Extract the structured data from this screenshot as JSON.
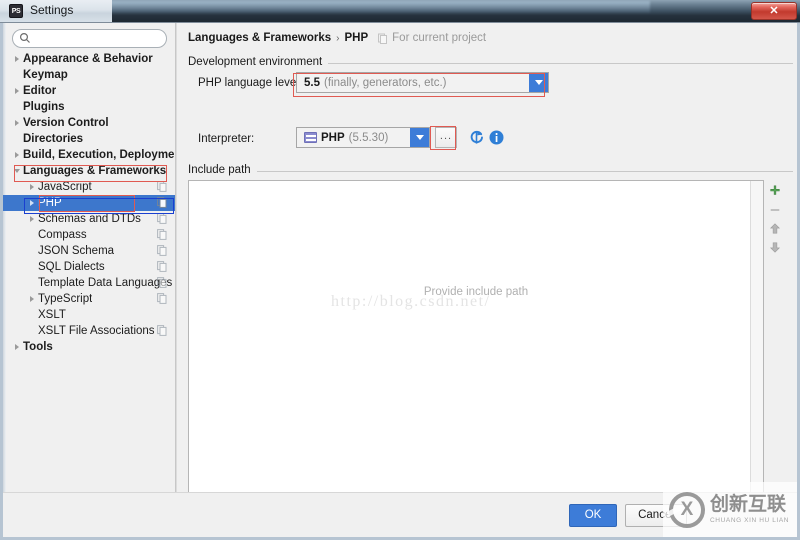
{
  "window": {
    "title": "Settings",
    "app_icon": "PS",
    "close_label": "✕"
  },
  "sidebar": {
    "search": {
      "value": "",
      "placeholder": ""
    },
    "items": [
      {
        "label": "Appearance & Behavior",
        "level": 0,
        "twisty": "right",
        "bold": true,
        "cfg": false,
        "selected": false
      },
      {
        "label": "Keymap",
        "level": 0,
        "twisty": "none",
        "bold": true,
        "cfg": false,
        "selected": false
      },
      {
        "label": "Editor",
        "level": 0,
        "twisty": "right",
        "bold": true,
        "cfg": false,
        "selected": false
      },
      {
        "label": "Plugins",
        "level": 0,
        "twisty": "none",
        "bold": true,
        "cfg": false,
        "selected": false
      },
      {
        "label": "Version Control",
        "level": 0,
        "twisty": "right",
        "bold": true,
        "cfg": false,
        "selected": false
      },
      {
        "label": "Directories",
        "level": 0,
        "twisty": "none",
        "bold": true,
        "cfg": false,
        "selected": false
      },
      {
        "label": "Build, Execution, Deployment",
        "level": 0,
        "twisty": "right",
        "bold": true,
        "cfg": false,
        "selected": false
      },
      {
        "label": "Languages & Frameworks",
        "level": 0,
        "twisty": "down",
        "bold": true,
        "cfg": false,
        "selected": false
      },
      {
        "label": "JavaScript",
        "level": 1,
        "twisty": "right",
        "bold": false,
        "cfg": true,
        "selected": false
      },
      {
        "label": "PHP",
        "level": 1,
        "twisty": "right",
        "bold": false,
        "cfg": true,
        "selected": true
      },
      {
        "label": "Schemas and DTDs",
        "level": 1,
        "twisty": "right",
        "bold": false,
        "cfg": true,
        "selected": false
      },
      {
        "label": "Compass",
        "level": 1,
        "twisty": "none",
        "bold": false,
        "cfg": true,
        "selected": false
      },
      {
        "label": "JSON Schema",
        "level": 1,
        "twisty": "none",
        "bold": false,
        "cfg": true,
        "selected": false
      },
      {
        "label": "SQL Dialects",
        "level": 1,
        "twisty": "none",
        "bold": false,
        "cfg": true,
        "selected": false
      },
      {
        "label": "Template Data Languages",
        "level": 1,
        "twisty": "none",
        "bold": false,
        "cfg": true,
        "selected": false
      },
      {
        "label": "TypeScript",
        "level": 1,
        "twisty": "right",
        "bold": false,
        "cfg": true,
        "selected": false
      },
      {
        "label": "XSLT",
        "level": 1,
        "twisty": "none",
        "bold": false,
        "cfg": false,
        "selected": false
      },
      {
        "label": "XSLT File Associations",
        "level": 1,
        "twisty": "none",
        "bold": false,
        "cfg": true,
        "selected": false
      },
      {
        "label": "Tools",
        "level": 0,
        "twisty": "right",
        "bold": true,
        "cfg": false,
        "selected": false
      }
    ]
  },
  "breadcrumb": {
    "root": "Languages & Frameworks",
    "separator": "›",
    "leaf": "PHP",
    "note": "For current project"
  },
  "main": {
    "dev_env_group_title": "Development environment",
    "php_level_label": "PHP language level:",
    "php_level_value_strong": "5.5",
    "php_level_value_muted": "(finally, generators, etc.)",
    "interpreter_label": "Interpreter:",
    "interpreter_value_strong": "PHP",
    "interpreter_value_muted": "(5.5.30)",
    "ellipsis_button_label": "...",
    "refresh_icon": "refresh-icon",
    "info_icon": "info-icon",
    "include_path_group_title": "Include path",
    "include_path_empty_hint": "Provide include path",
    "toolbar": {
      "add_label": "+",
      "remove_label": "−",
      "up_label": "▲",
      "down_label": "▼"
    }
  },
  "footer": {
    "ok_label": "OK",
    "cancel_label": "Cancel"
  },
  "watermarks": {
    "url": "http://blog.csdn.net/",
    "logo_cn": "创新互联",
    "logo_en": "CHUANG XIN HU LIAN"
  },
  "colors": {
    "accent_blue": "#3d7cd8",
    "selection_blue": "#3d77cc",
    "annotation_red": "#e05a52",
    "annotation_blue": "#1a3fd0",
    "add_green": "#4f9e4f"
  }
}
